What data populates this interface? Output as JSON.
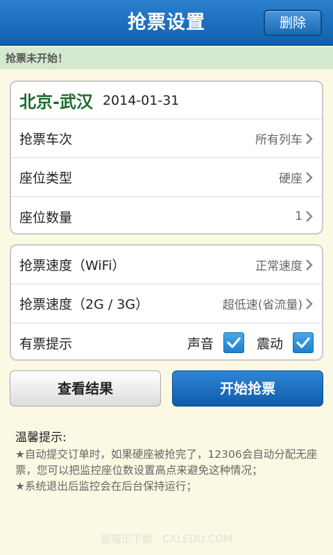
{
  "header": {
    "title": "抢票设置",
    "delete_label": "删除"
  },
  "status": "抢票未开始！",
  "route": {
    "name": "北京-武汉",
    "date": "2014-01-31"
  },
  "settings": [
    {
      "label": "抢票车次",
      "value": "所有列车"
    },
    {
      "label": "座位类型",
      "value": "硬座"
    },
    {
      "label": "座位数量",
      "value": "1"
    }
  ],
  "speed": [
    {
      "label": "抢票速度（WiFi）",
      "value": "正常速度"
    },
    {
      "label": "抢票速度（2G / 3G）",
      "value": "超低速(省流量)"
    }
  ],
  "notify": {
    "label": "有票提示",
    "sound_label": "声音",
    "sound_checked": true,
    "vibrate_label": "震动",
    "vibrate_checked": true
  },
  "buttons": {
    "result_label": "查看结果",
    "start_label": "开始抢票"
  },
  "tips": {
    "title": "温馨提示:",
    "items": [
      "★自动提交订单时，如果硬座被抢完了，12306会自动分配无座票，您可以把监控座位数设置高点来避免这种情况；",
      "★系统退出后监控会在后台保持运行；"
    ]
  },
  "watermark": "窗暗乐下载 · CXLEDU.COM",
  "colors": {
    "header_blue": "#1a6dbb",
    "route_green": "#1d6a2c",
    "status_bg": "#d4e8cf",
    "page_bg": "#fbf8e4"
  }
}
